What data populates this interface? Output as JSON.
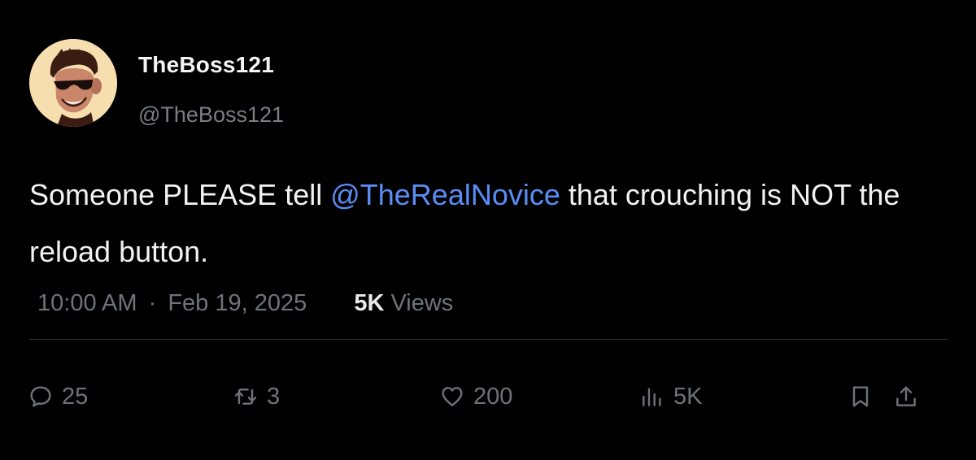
{
  "user": {
    "display_name": "TheBoss121",
    "handle": "@TheBoss121"
  },
  "tweet": {
    "text_before": "Someone PLEASE tell ",
    "mention": "@TheRealNovice",
    "text_after": " that crouching is NOT the reload button.",
    "time": "10:00 AM",
    "separator": "·",
    "date": "Feb 19, 2025",
    "views_count": "5K",
    "views_label": " Views"
  },
  "actions": {
    "reply": {
      "icon": "reply-icon",
      "count": "25"
    },
    "retweet": {
      "icon": "retweet-icon",
      "count": "3"
    },
    "like": {
      "icon": "heart-icon",
      "count": "200"
    },
    "views": {
      "icon": "analytics-icon",
      "count": "5K"
    },
    "bookmark": {
      "icon": "bookmark-icon"
    },
    "share": {
      "icon": "share-icon"
    }
  },
  "colors": {
    "background": "#000000",
    "mention": "#5b8df6",
    "muted": "#6f7378",
    "divider": "#2f3336"
  }
}
